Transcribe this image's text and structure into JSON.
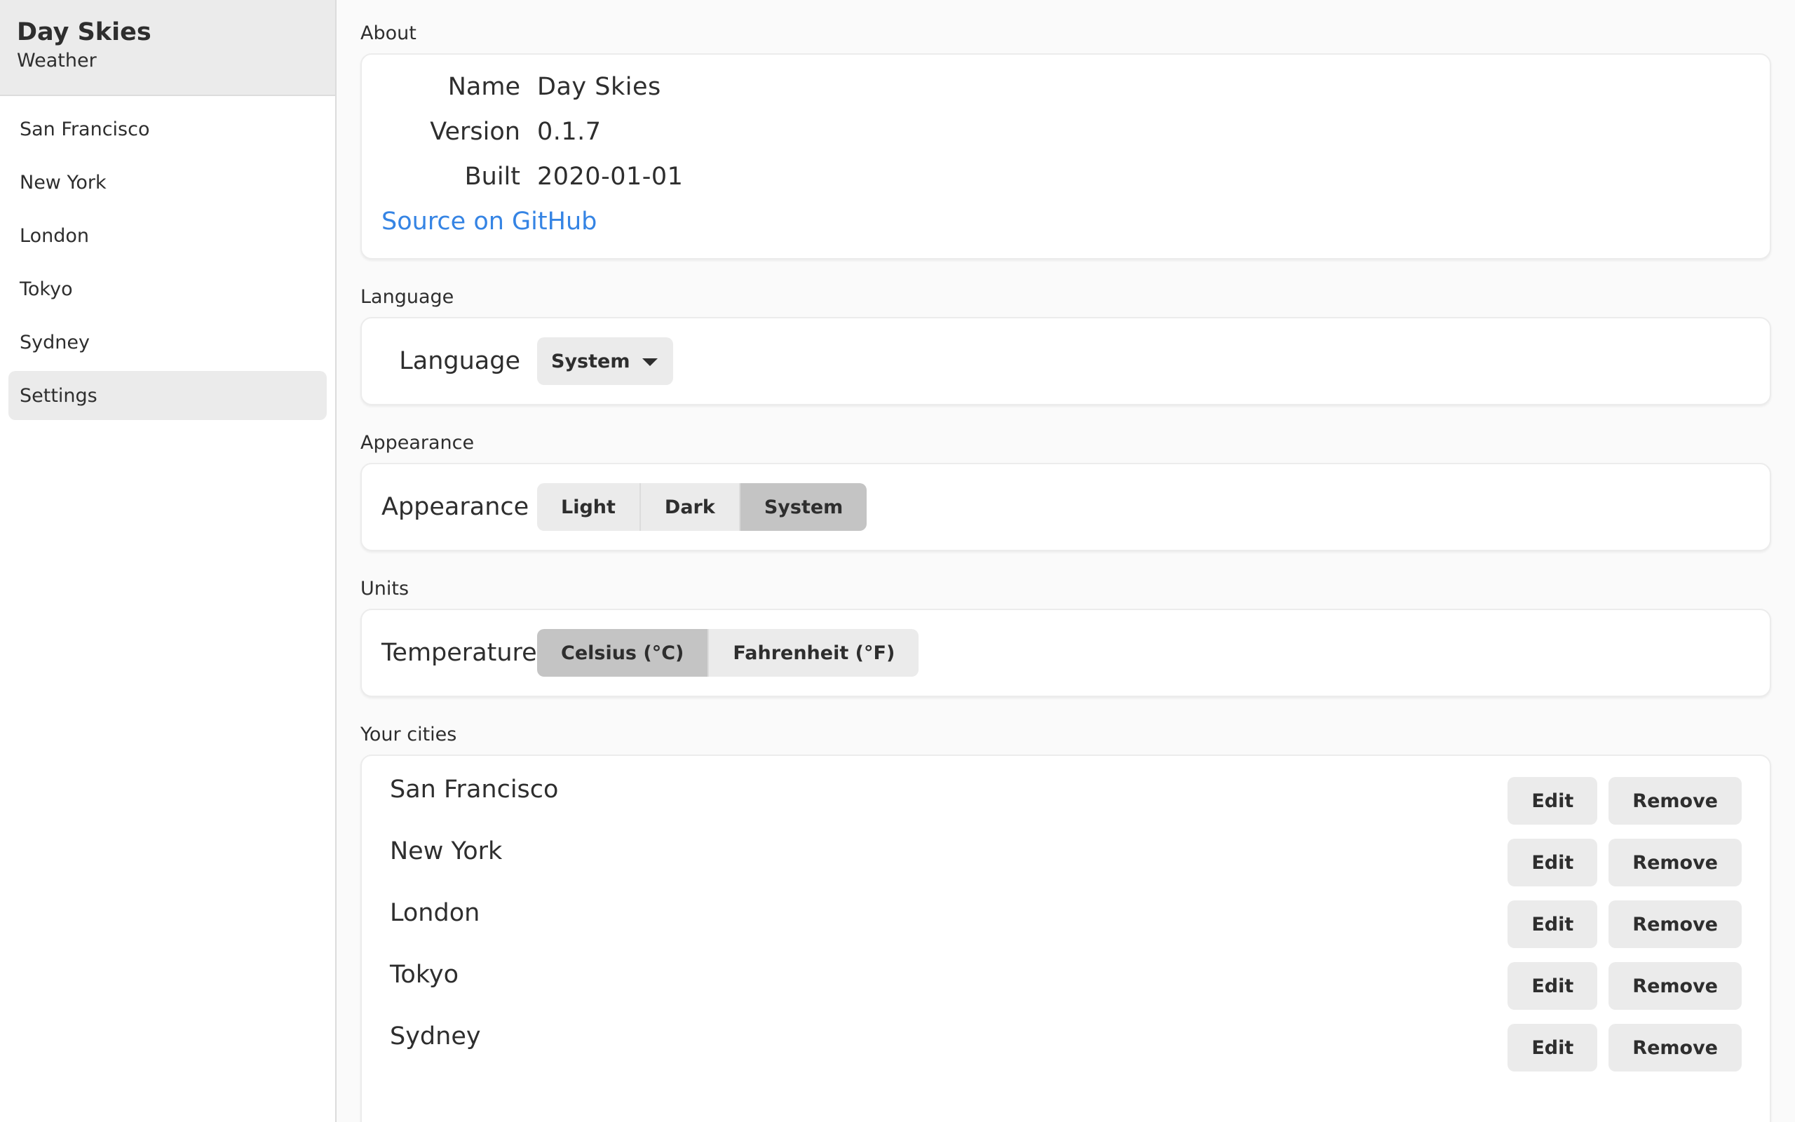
{
  "app": {
    "title": "Day Skies",
    "subtitle": "Weather"
  },
  "sidebar": {
    "items": [
      {
        "label": "San Francisco",
        "selected": false
      },
      {
        "label": "New York",
        "selected": false
      },
      {
        "label": "London",
        "selected": false
      },
      {
        "label": "Tokyo",
        "selected": false
      },
      {
        "label": "Sydney",
        "selected": false
      },
      {
        "label": "Settings",
        "selected": true
      }
    ]
  },
  "about": {
    "section_label": "About",
    "name_key": "Name",
    "name_value": "Day Skies",
    "version_key": "Version",
    "version_value": "0.1.7",
    "built_key": "Built",
    "built_value": "2020-01-01",
    "link_text": "Source on GitHub"
  },
  "language": {
    "section_label": "Language",
    "row_label": "Language",
    "selected": "System"
  },
  "appearance": {
    "section_label": "Appearance",
    "row_label": "Appearance",
    "options": [
      "Light",
      "Dark",
      "System"
    ],
    "selected": "System"
  },
  "units": {
    "section_label": "Units",
    "row_label": "Temperature",
    "options": [
      "Celsius (°C)",
      "Fahrenheit (°F)"
    ],
    "selected": "Celsius (°C)"
  },
  "cities": {
    "section_label": "Your cities",
    "edit_label": "Edit",
    "remove_label": "Remove",
    "items": [
      {
        "name": "San Francisco"
      },
      {
        "name": "New York"
      },
      {
        "name": "London"
      },
      {
        "name": "Tokyo"
      },
      {
        "name": "Sydney"
      }
    ]
  },
  "colors": {
    "accent_link": "#3584e4",
    "selected_bg": "#ebebeb",
    "active_segment": "#c4c4c4"
  }
}
